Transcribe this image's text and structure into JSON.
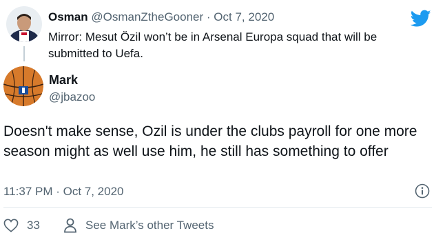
{
  "parent_tweet": {
    "display_name": "Osman",
    "handle": "@OsmanZtheGooner",
    "separator": "·",
    "date": "Oct 7, 2020",
    "text": "Mirror: Mesut Özil won’t be in Arsenal Europa squad that will be submitted to Uefa."
  },
  "main_tweet": {
    "display_name": "Mark",
    "handle": "@jbazoo",
    "text": "Doesn't make sense, Ozil is under the clubs payroll for one more season might as well use him, he still has something to offer",
    "timestamp": "11:37 PM · Oct 7, 2020",
    "avatar_logo_text": "SPALDING"
  },
  "actions": {
    "like_count": "33",
    "profile_link_label": "See Mark’s other Tweets"
  },
  "icons": {
    "brand": "twitter-bird-icon",
    "info": "info-icon",
    "like": "heart-icon",
    "profile": "person-icon"
  },
  "colors": {
    "twitter_blue": "#1d9bf0",
    "secondary_text": "#536471",
    "primary_text": "#0f1419"
  }
}
